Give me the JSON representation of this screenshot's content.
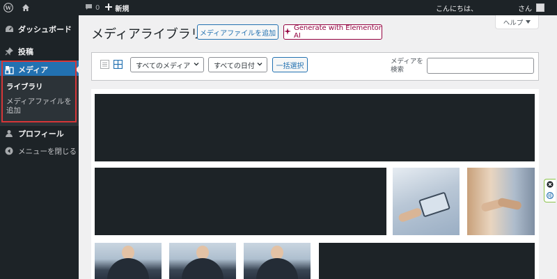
{
  "adminbar": {
    "comments_count": "0",
    "new_label": "新規",
    "greeting": "こんにちは、",
    "user_suffix": "さん"
  },
  "sidebar": {
    "dashboard": "ダッシュボード",
    "posts": "投稿",
    "media": "メディア",
    "submenu": {
      "library": "ライブラリ",
      "add_new": "メディアファイルを追加"
    },
    "profile": "プロフィール",
    "collapse": "メニューを閉じる"
  },
  "header": {
    "title": "メディアライブラリ",
    "add_button": "メディアファイルを追加",
    "elementor_button": "Generate with Elementor AI",
    "help_tab": "ヘルプ"
  },
  "filters": {
    "type_select": "すべてのメディア",
    "date_select": "すべての日付",
    "bulk_select": "一括選択",
    "search_label": "メディアを検索",
    "search_value": ""
  },
  "colors": {
    "admin_dark": "#1d2327",
    "accent": "#2271b1",
    "highlight": "#d63638",
    "elementor": "#93003f"
  },
  "icons": [
    "wordpress-logo-icon",
    "home-icon",
    "comment-icon",
    "plus-icon",
    "dashboard-icon",
    "pin-icon",
    "media-icon",
    "user-icon",
    "collapse-icon",
    "list-view-icon",
    "grid-view-icon",
    "sparkle-icon",
    "chevron-down-icon",
    "close-circle-icon",
    "elementor-icon"
  ]
}
